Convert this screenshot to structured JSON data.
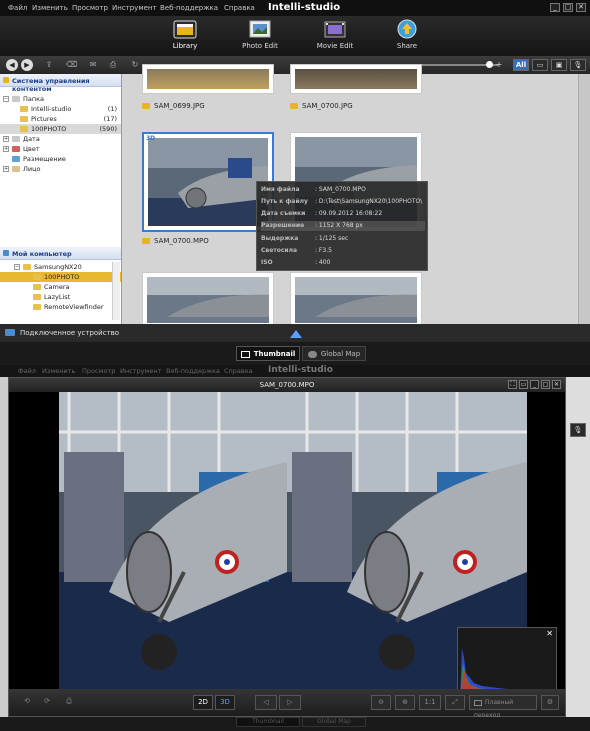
{
  "app": {
    "title": "Intelli-studio",
    "menu": [
      "Файл",
      "Изменить",
      "Просмотр",
      "Инструмент",
      "Веб-поддержка",
      "Справка"
    ],
    "window_controls": [
      "_",
      "□",
      "✕"
    ]
  },
  "toolbar": {
    "tools": [
      {
        "label": "Library",
        "icon": "library-icon",
        "color": "#e8b420"
      },
      {
        "label": "Photo Edit",
        "icon": "photo-edit-icon",
        "color": "#5a8fd0"
      },
      {
        "label": "Movie Edit",
        "icon": "movie-edit-icon",
        "color": "#8a6fd0"
      },
      {
        "label": "Share",
        "icon": "share-icon",
        "color": "#3aa0e0"
      }
    ],
    "view_buttons": [
      "All",
      "▭",
      "▣",
      "🎙"
    ]
  },
  "sidebar": {
    "content_header": "Система управления контентом",
    "tree": [
      {
        "label": "Папка",
        "count": "",
        "level": 0,
        "expander": "−"
      },
      {
        "label": "Intelli-studio",
        "count": "(1)",
        "level": 1,
        "expander": ""
      },
      {
        "label": "Pictures",
        "count": "(17)",
        "level": 1,
        "expander": ""
      },
      {
        "label": "100PHOTO",
        "count": "(590)",
        "level": 1,
        "expander": "",
        "selected": true
      },
      {
        "label": "Дата",
        "count": "",
        "level": 0,
        "expander": "+"
      },
      {
        "label": "Цвет",
        "count": "",
        "level": 0,
        "expander": "+"
      },
      {
        "label": "Размещение",
        "count": "",
        "level": 0,
        "expander": ""
      },
      {
        "label": "Лицо",
        "count": "",
        "level": 0,
        "expander": "+"
      }
    ],
    "computer_header": "Мой компьютер",
    "computer_tree": [
      {
        "label": "SamsungNX20",
        "level": 1,
        "expander": "−"
      },
      {
        "label": "100PHOTO",
        "level": 2,
        "selected": true
      },
      {
        "label": "Camera",
        "level": 2
      },
      {
        "label": "LazyList",
        "level": 2
      },
      {
        "label": "RemoteViewfinder",
        "level": 2
      }
    ]
  },
  "grid": {
    "items": [
      {
        "name": "SAM_0699.JPG"
      },
      {
        "name": "SAM_0700.JPG"
      },
      {
        "name": "SAM_0700.MPO"
      },
      {
        "name": ""
      },
      {
        "name": ""
      },
      {
        "name": ""
      }
    ],
    "selected_badge": "3D"
  },
  "tooltip": {
    "rows": [
      {
        "key": "Имя файла",
        "value": ": SAM_0700.MPO"
      },
      {
        "key": "Путь к файлу",
        "value": ": D:\\Test\\SamsungNX20\\100PHOTO\\"
      },
      {
        "key": "Дата съемки",
        "value": ": 09.09.2012 16:08:22"
      },
      {
        "key": "Разрешение",
        "value": ": 1152 X 768 px"
      },
      {
        "key": "Выдержка",
        "value": ": 1/125 sec"
      },
      {
        "key": "Светосила",
        "value": ": F3.5"
      },
      {
        "key": "ISO",
        "value": ": 400"
      }
    ]
  },
  "device_bar": {
    "label": "Подключенное устройство"
  },
  "tabs": [
    {
      "label": "Thumbnail",
      "active": true
    },
    {
      "label": "Global Map",
      "active": false
    }
  ],
  "viewer": {
    "title": "SAM_0700.MPO",
    "controls": [
      "⛶",
      "▭",
      "_",
      "□",
      "✕"
    ],
    "bottom": {
      "mode_2d": "2D",
      "mode_3d": "3D",
      "ratio": "1:1",
      "slideshow": "Плавный переход"
    },
    "histogram_close": "✕"
  },
  "colors": {
    "accent": "#3a7ad0",
    "folder": "#e8b420",
    "selection": "#e8b830"
  }
}
